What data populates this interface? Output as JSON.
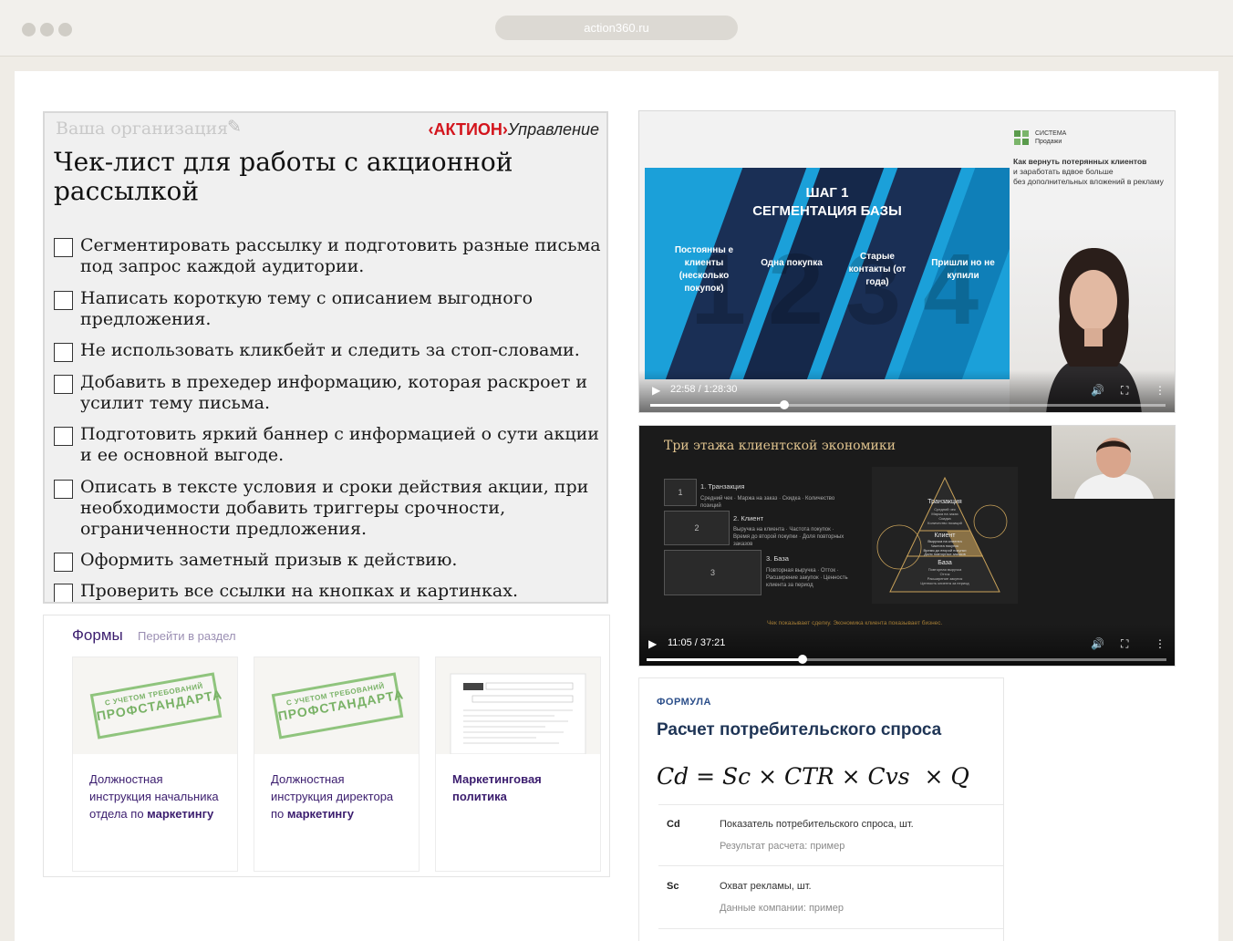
{
  "browser": {
    "url": "action360.ru"
  },
  "checklist": {
    "org_placeholder": "Ваша организация",
    "brand_red": "‹АКТИОН›",
    "brand_black": "Управление",
    "title": "Чек-лист для работы с акционной рассылкой",
    "items": [
      "Сегментировать рассылку и подготовить разные письма под запрос каждой аудитории.",
      "Написать короткую тему с описанием выгодного предложения.",
      "Не использовать кликбейт и следить за стоп-словами.",
      "Добавить в прехедер информацию, которая раскроет и усилит тему письма.",
      "Подготовить яркий баннер с информацией о сути акции и ее основной выгоде.",
      "Описать в тексте условия и сроки действия акции, при необходимости добавить триггеры срочности, ограниченности предложения.",
      "Оформить заметный призыв к действию.",
      "Проверить все ссылки на кнопках и картинках."
    ]
  },
  "forms": {
    "title": "Формы",
    "link": "Перейти в раздел",
    "stamp_line1": "С УЧЕТОМ ТРЕБОВАНИЙ",
    "stamp_line2": "ПРОФСТАНДАРТА",
    "cards": [
      {
        "text": "Должностная инструкция начальника отдела по ",
        "bold": "маркетингу"
      },
      {
        "text": "Должностная инструкция директора по ",
        "bold": "маркетингу"
      },
      {
        "text": "",
        "bold": "Маркетинговая политика"
      }
    ]
  },
  "video1": {
    "slide_title_line1": "ШАГ 1",
    "slide_title_line2": "СЕГМЕНТАЦИЯ БАЗЫ",
    "columns": [
      "Постоянны е клиенты (несколько покупок)",
      "Одна покупка",
      "Старые контакты (от года)",
      "Пришли но не купили"
    ],
    "numbers": [
      "1",
      "2",
      "3",
      "4"
    ],
    "brand_line1": "СИСТЕМА",
    "brand_line2": "Продажи",
    "headline": "Как вернуть потерянных клиентов",
    "subline1": "и заработать вдвое больше",
    "subline2": "без дополнительных вложений в рекламу",
    "time": "22:58 / 1:28:30",
    "progress": 0.26
  },
  "video2": {
    "title": "Три этажа клиентской экономики",
    "levels": [
      {
        "num": "1",
        "head": "1. Транзакция",
        "sub": "Средний чек · Маржа на заказ · Скидка · Количество позиций"
      },
      {
        "num": "2",
        "head": "2. Клиент",
        "sub": "Выручка на клиента · Частота покупок · Время до второй покупки · Доля повторных заказов"
      },
      {
        "num": "3",
        "head": "3. База",
        "sub": "Повторная выручка · Отток · Расширение закупок · Ценность клиента за период"
      }
    ],
    "pyramid": {
      "top": "Транзакция",
      "top_sub": [
        "Средний чек",
        "Маржа на заказ",
        "Скидка",
        "Количество позиций"
      ],
      "mid": "Клиент",
      "mid_sub": [
        "Выручка на клиента",
        "Частота покупок",
        "Время до второй покупки",
        "Доля повторных заказов"
      ],
      "base": "База",
      "base_sub": [
        "Повторная выручка",
        "Отток",
        "Расширение закупок",
        "Ценность клиента за период"
      ]
    },
    "caption": "Чек показывает сделку. Экономика клиента показывает бизнес.",
    "time": "11:05 / 37:21",
    "progress": 0.3
  },
  "formula": {
    "label": "ФОРМУЛА",
    "title": "Расчет потребительского спроса",
    "expression": [
      "Cd",
      "=",
      "Sc",
      "×",
      "CTR",
      "×",
      "Cvs",
      "×",
      "Q"
    ],
    "variables": [
      {
        "name": "Cd",
        "desc": "Показатель потребительского спроса, шт.",
        "note": "Результат расчета: пример"
      },
      {
        "name": "Sc",
        "desc": "Охват рекламы, шт.",
        "note": "Данные компании: пример"
      }
    ]
  },
  "colors": {
    "brand_red": "#d3141c",
    "forms_purple": "#3b1d6e",
    "formula_blue": "#1f3556",
    "slide_blue": "#1ba0d9",
    "gold": "#e1c48f"
  }
}
